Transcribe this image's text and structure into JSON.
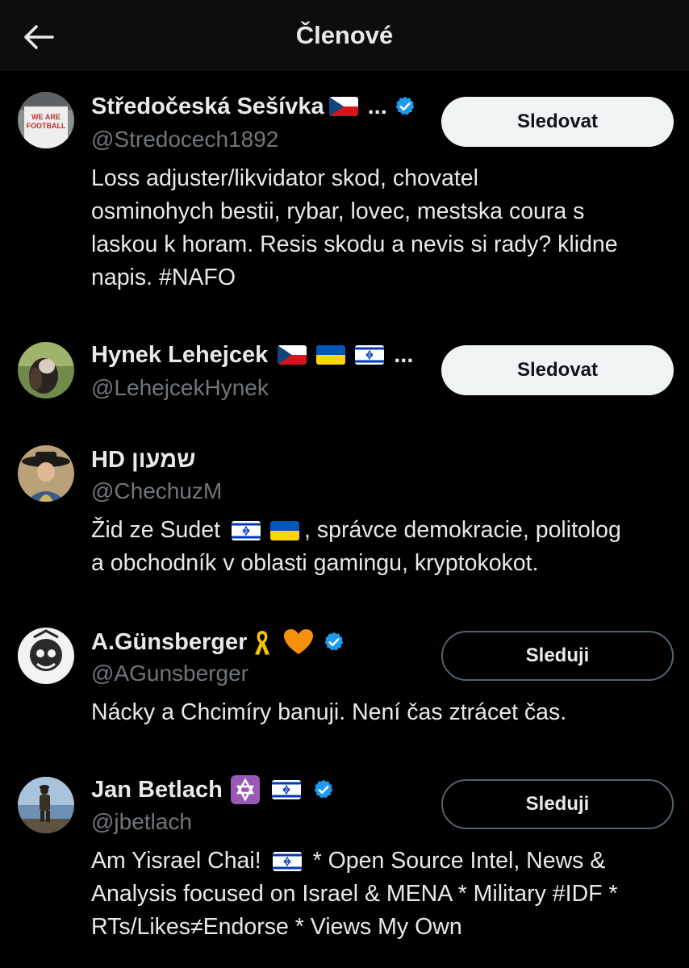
{
  "header": {
    "title": "Členové"
  },
  "members": [
    {
      "name": "Středočeská Sešívka",
      "name_suffix": "...",
      "handle": "@Stredocech1892",
      "bio_lines": [
        "Loss adjuster/likvidator skod, chovatel",
        "osminohych bestii, rybar, lovec, mestska coura s",
        "laskou k horam. Resis skodu a nevis si rady? klidne",
        "napis. #NAFO"
      ],
      "button": "Sledovat",
      "avatar_text_1": "WE ARE",
      "avatar_text_2": "FOOTBALL"
    },
    {
      "name": "Hynek Lehejcek",
      "name_suffix": "...",
      "handle": "@LehejcekHynek",
      "button": "Sledovat"
    },
    {
      "name": "HD שמעון",
      "handle": "@ChechuzM",
      "bio_line1_start": "Žid ze Sudet",
      "bio_line1_end": ", správce demokracie, politolog",
      "bio_line2": "a obchodník v oblasti gamingu, kryptokokot."
    },
    {
      "name": "A.Günsberger",
      "handle": "@AGunsberger",
      "bio_line1": "Nácky a Chcimíry banuji. Není čas ztrácet čas.",
      "button": "Sleduji"
    },
    {
      "name": "Jan Betlach",
      "handle": "@jbetlach",
      "bio_line1_start": "Am Yisrael Chai!",
      "bio_line1_end": " * Open Source Intel, News &",
      "bio_line2": "Analysis focused on Israel & MENA * Military #IDF *",
      "bio_line3": "RTs/Likes≠Endorse * Views My Own",
      "button": "Sleduji"
    }
  ],
  "colors": {
    "background": "#000000",
    "text": "#e7e9ea",
    "muted": "#71767b",
    "verified": "#1d9bf0",
    "follow_button_bg": "#eff3f4"
  },
  "icons": [
    "back-arrow-icon",
    "verified-badge-icon",
    "czech-flag-icon",
    "ukraine-flag-icon",
    "israel-flag-icon",
    "yellow-ribbon-icon",
    "orange-heart-icon",
    "star-of-david-icon"
  ]
}
